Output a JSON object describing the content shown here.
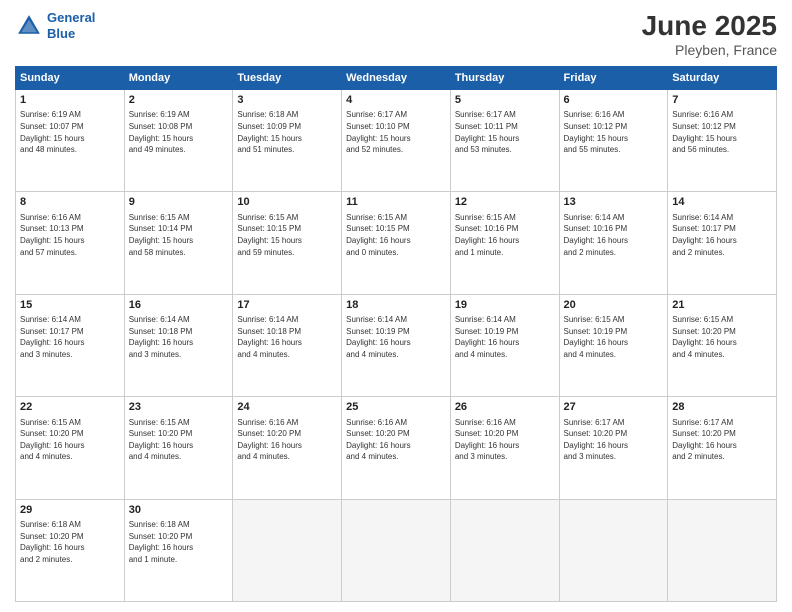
{
  "header": {
    "logo_line1": "General",
    "logo_line2": "Blue",
    "title": "June 2025",
    "subtitle": "Pleyben, France"
  },
  "columns": [
    "Sunday",
    "Monday",
    "Tuesday",
    "Wednesday",
    "Thursday",
    "Friday",
    "Saturday"
  ],
  "weeks": [
    [
      {
        "day": "1",
        "info": "Sunrise: 6:19 AM\nSunset: 10:07 PM\nDaylight: 15 hours\nand 48 minutes."
      },
      {
        "day": "2",
        "info": "Sunrise: 6:19 AM\nSunset: 10:08 PM\nDaylight: 15 hours\nand 49 minutes."
      },
      {
        "day": "3",
        "info": "Sunrise: 6:18 AM\nSunset: 10:09 PM\nDaylight: 15 hours\nand 51 minutes."
      },
      {
        "day": "4",
        "info": "Sunrise: 6:17 AM\nSunset: 10:10 PM\nDaylight: 15 hours\nand 52 minutes."
      },
      {
        "day": "5",
        "info": "Sunrise: 6:17 AM\nSunset: 10:11 PM\nDaylight: 15 hours\nand 53 minutes."
      },
      {
        "day": "6",
        "info": "Sunrise: 6:16 AM\nSunset: 10:12 PM\nDaylight: 15 hours\nand 55 minutes."
      },
      {
        "day": "7",
        "info": "Sunrise: 6:16 AM\nSunset: 10:12 PM\nDaylight: 15 hours\nand 56 minutes."
      }
    ],
    [
      {
        "day": "8",
        "info": "Sunrise: 6:16 AM\nSunset: 10:13 PM\nDaylight: 15 hours\nand 57 minutes."
      },
      {
        "day": "9",
        "info": "Sunrise: 6:15 AM\nSunset: 10:14 PM\nDaylight: 15 hours\nand 58 minutes."
      },
      {
        "day": "10",
        "info": "Sunrise: 6:15 AM\nSunset: 10:15 PM\nDaylight: 15 hours\nand 59 minutes."
      },
      {
        "day": "11",
        "info": "Sunrise: 6:15 AM\nSunset: 10:15 PM\nDaylight: 16 hours\nand 0 minutes."
      },
      {
        "day": "12",
        "info": "Sunrise: 6:15 AM\nSunset: 10:16 PM\nDaylight: 16 hours\nand 1 minute."
      },
      {
        "day": "13",
        "info": "Sunrise: 6:14 AM\nSunset: 10:16 PM\nDaylight: 16 hours\nand 2 minutes."
      },
      {
        "day": "14",
        "info": "Sunrise: 6:14 AM\nSunset: 10:17 PM\nDaylight: 16 hours\nand 2 minutes."
      }
    ],
    [
      {
        "day": "15",
        "info": "Sunrise: 6:14 AM\nSunset: 10:17 PM\nDaylight: 16 hours\nand 3 minutes."
      },
      {
        "day": "16",
        "info": "Sunrise: 6:14 AM\nSunset: 10:18 PM\nDaylight: 16 hours\nand 3 minutes."
      },
      {
        "day": "17",
        "info": "Sunrise: 6:14 AM\nSunset: 10:18 PM\nDaylight: 16 hours\nand 4 minutes."
      },
      {
        "day": "18",
        "info": "Sunrise: 6:14 AM\nSunset: 10:19 PM\nDaylight: 16 hours\nand 4 minutes."
      },
      {
        "day": "19",
        "info": "Sunrise: 6:14 AM\nSunset: 10:19 PM\nDaylight: 16 hours\nand 4 minutes."
      },
      {
        "day": "20",
        "info": "Sunrise: 6:15 AM\nSunset: 10:19 PM\nDaylight: 16 hours\nand 4 minutes."
      },
      {
        "day": "21",
        "info": "Sunrise: 6:15 AM\nSunset: 10:20 PM\nDaylight: 16 hours\nand 4 minutes."
      }
    ],
    [
      {
        "day": "22",
        "info": "Sunrise: 6:15 AM\nSunset: 10:20 PM\nDaylight: 16 hours\nand 4 minutes."
      },
      {
        "day": "23",
        "info": "Sunrise: 6:15 AM\nSunset: 10:20 PM\nDaylight: 16 hours\nand 4 minutes."
      },
      {
        "day": "24",
        "info": "Sunrise: 6:16 AM\nSunset: 10:20 PM\nDaylight: 16 hours\nand 4 minutes."
      },
      {
        "day": "25",
        "info": "Sunrise: 6:16 AM\nSunset: 10:20 PM\nDaylight: 16 hours\nand 4 minutes."
      },
      {
        "day": "26",
        "info": "Sunrise: 6:16 AM\nSunset: 10:20 PM\nDaylight: 16 hours\nand 3 minutes."
      },
      {
        "day": "27",
        "info": "Sunrise: 6:17 AM\nSunset: 10:20 PM\nDaylight: 16 hours\nand 3 minutes."
      },
      {
        "day": "28",
        "info": "Sunrise: 6:17 AM\nSunset: 10:20 PM\nDaylight: 16 hours\nand 2 minutes."
      }
    ],
    [
      {
        "day": "29",
        "info": "Sunrise: 6:18 AM\nSunset: 10:20 PM\nDaylight: 16 hours\nand 2 minutes."
      },
      {
        "day": "30",
        "info": "Sunrise: 6:18 AM\nSunset: 10:20 PM\nDaylight: 16 hours\nand 1 minute."
      },
      {
        "day": "",
        "info": ""
      },
      {
        "day": "",
        "info": ""
      },
      {
        "day": "",
        "info": ""
      },
      {
        "day": "",
        "info": ""
      },
      {
        "day": "",
        "info": ""
      }
    ]
  ]
}
